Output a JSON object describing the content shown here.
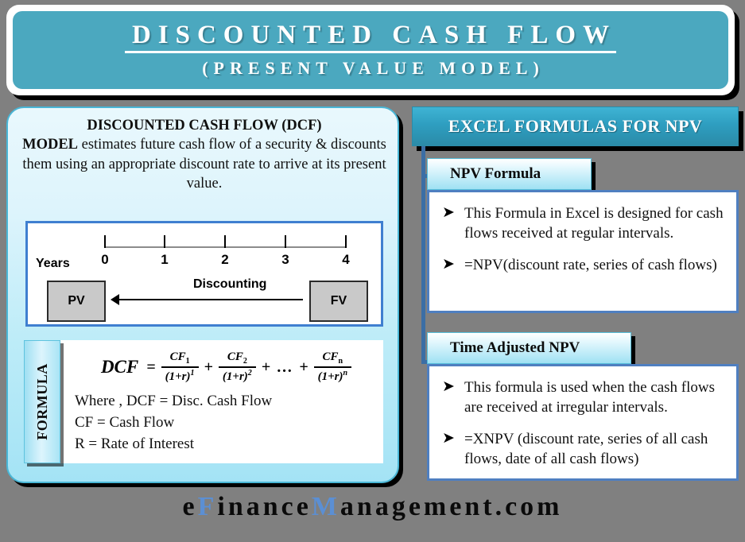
{
  "header": {
    "title": "DISCOUNTED CASH FLOW",
    "subtitle": "(PRESENT VALUE MODEL)"
  },
  "left_panel": {
    "description_bold_1": "DISCOUNTED CASH  FLOW (DCF)",
    "description_bold_2": "MODEL",
    "description_rest": "  estimates future cash flow of a security & discounts them using an appropriate discount rate to arrive at its present value.",
    "timeline": {
      "axis_label": "Years",
      "ticks": [
        "0",
        "1",
        "2",
        "3",
        "4"
      ],
      "pv_label": "PV",
      "fv_label": "FV",
      "arrow_label": "Discounting"
    },
    "formula": {
      "tab_label": "FORMULA",
      "lhs": "DCF",
      "equals": "=",
      "terms": [
        {
          "numerator": "CF",
          "num_sub": "1",
          "denominator": "(1+r)",
          "den_sup": "1"
        },
        {
          "numerator": "CF",
          "num_sub": "2",
          "denominator": "(1+r)",
          "den_sup": "2"
        },
        {
          "numerator": "CF",
          "num_sub": "n",
          "denominator": "(1+r)",
          "den_sup": "n"
        }
      ],
      "ellipsis": "…",
      "plus": "+",
      "where_line_1": "Where , DCF = Disc. Cash Flow",
      "where_line_2": "CF = Cash Flow",
      "where_line_3": "R = Rate of Interest"
    }
  },
  "right_panel": {
    "section_title": "EXCEL FORMULAS FOR NPV",
    "blocks": [
      {
        "tab_label": "NPV Formula",
        "bullet_marker": "➤",
        "bullets": [
          "This Formula in Excel is designed for cash flows received at regular intervals.",
          "=NPV(discount rate, series of cash flows)"
        ]
      },
      {
        "tab_label": "Time Adjusted NPV",
        "bullet_marker": "➤",
        "bullets": [
          "This formula is used when the cash flows are received at irregular intervals.",
          "=XNPV (discount rate, series of all cash flows, date of all cash flows)"
        ]
      }
    ]
  },
  "footer": {
    "part_1": "e",
    "part_2": "F",
    "part_3": "inance",
    "part_4": "M",
    "part_5": "anagement.com"
  },
  "colors": {
    "background": "#808080",
    "header_teal": "#4ba8bf",
    "panel_cyan": "#a4e3f5",
    "connector_blue": "#3b6ea5",
    "box_border_blue": "#4f7fc0",
    "footer_accent": "#5b8fd4"
  }
}
